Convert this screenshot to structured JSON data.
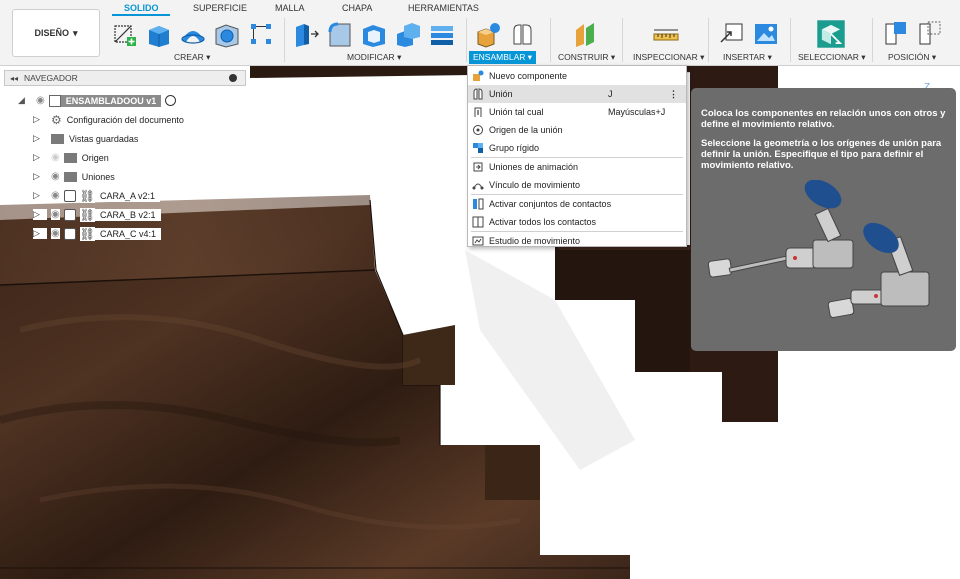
{
  "ribbon": {
    "design_label": "DISEÑO",
    "tabs": [
      "SOLIDO",
      "SUPERFICIE",
      "MALLA",
      "CHAPA",
      "HERRAMIENTAS"
    ],
    "groups": {
      "crear": "CREAR",
      "modificar": "MODIFICAR",
      "ensamblar": "ENSAMBLAR",
      "construir": "CONSTRUIR",
      "inspeccionar": "INSPECCIONAR",
      "insertar": "INSERTAR",
      "seleccionar": "SELECCIONAR",
      "posicion": "POSICIÓN"
    },
    "accent": "#0696d7"
  },
  "navigator": {
    "title": "NAVEGADOR",
    "items": [
      {
        "label": "ENSAMBLADOOU v1"
      },
      {
        "label": "Configuración del documento"
      },
      {
        "label": "Vistas guardadas"
      },
      {
        "label": "Origen"
      },
      {
        "label": "Uniones"
      },
      {
        "label": "CARA_A v2:1"
      },
      {
        "label": "CARA_B v2:1"
      },
      {
        "label": "CARA_C v4:1"
      }
    ]
  },
  "menu": {
    "items": [
      {
        "label": "Nuevo componente",
        "shortcut": ""
      },
      {
        "label": "Unión",
        "shortcut": "J"
      },
      {
        "label": "Unión tal cual",
        "shortcut": "Mayúsculas+J"
      },
      {
        "label": "Origen de la unión",
        "shortcut": ""
      },
      {
        "label": "Grupo rígido",
        "shortcut": ""
      },
      {
        "label": "Uniones de animación",
        "shortcut": ""
      },
      {
        "label": "Vínculo de movimiento",
        "shortcut": ""
      },
      {
        "label": "Activar conjuntos de contactos",
        "shortcut": ""
      },
      {
        "label": "Activar todos los contactos",
        "shortcut": ""
      },
      {
        "label": "Estudio de movimiento",
        "shortcut": ""
      }
    ]
  },
  "tooltip": {
    "text1": "Coloca los componentes en relación unos con otros y define el movimiento relativo.",
    "text2": "Seleccione la geometría o los orígenes de unión para definir la unión. Especifique el tipo para definir el movimiento relativo."
  },
  "viewcube": {
    "axis": "Z"
  }
}
